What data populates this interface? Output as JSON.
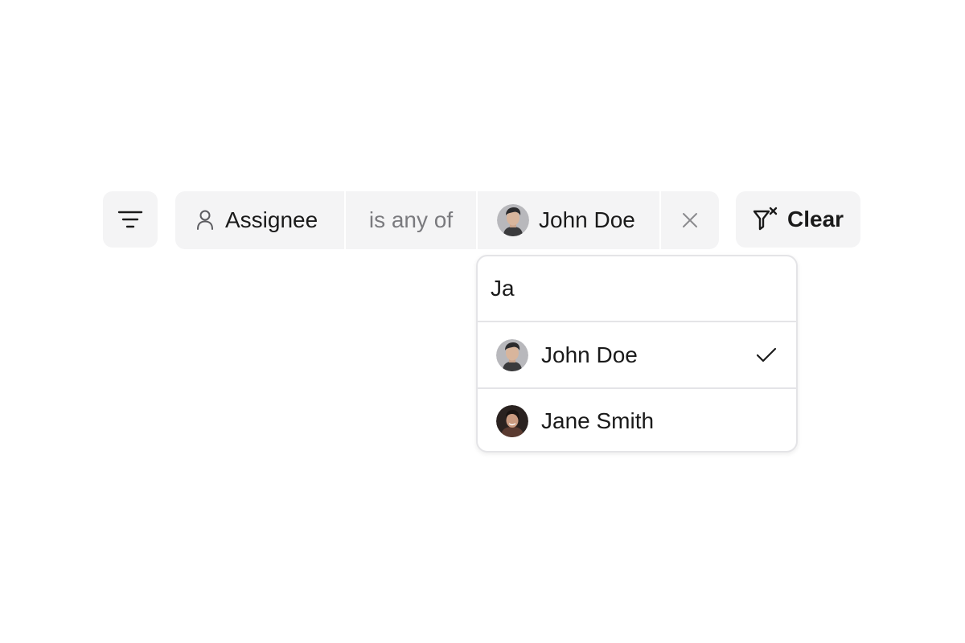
{
  "filter_toolbar": {
    "menu_button_icon": "filter-lines-icon",
    "filter": {
      "field_icon": "user-icon",
      "field_label": "Assignee",
      "operator_label": "is any of",
      "value_label": "John Doe",
      "remove_icon": "close-icon"
    },
    "clear_button": {
      "icon": "filter-clear-icon",
      "label": "Clear"
    }
  },
  "dropdown": {
    "search_value": "Ja",
    "options": [
      {
        "label": "John Doe",
        "selected": true,
        "check_icon": "check-icon"
      },
      {
        "label": "Jane Smith",
        "selected": false
      }
    ]
  },
  "colors": {
    "chip_background": "#f4f4f5",
    "text_primary": "#1a1a1a",
    "text_muted": "#7a7a7e",
    "divider": "#e4e4e7"
  }
}
